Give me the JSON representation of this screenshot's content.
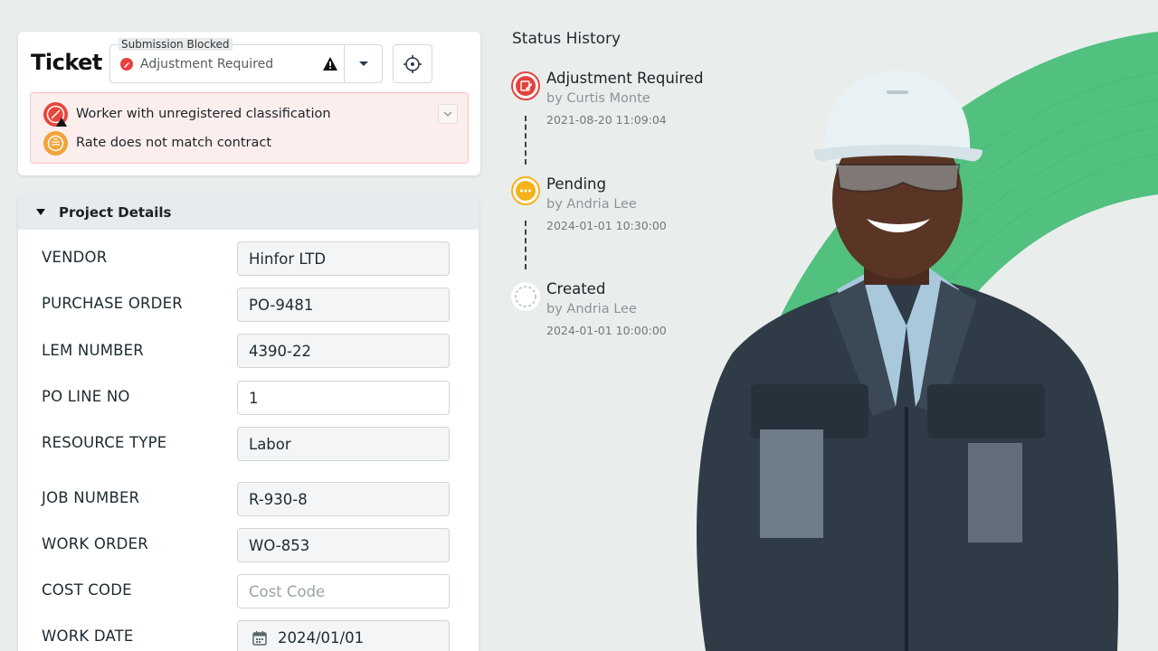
{
  "ticket": {
    "title": "Ticket",
    "status_label": "Submission Blocked",
    "status_value": "Adjustment Required",
    "issues": [
      {
        "text": "Worker with unregistered classification",
        "icon": "worker-warning-icon"
      },
      {
        "text": "Rate does not match contract",
        "icon": "rate-coin-icon"
      }
    ]
  },
  "details": {
    "title": "Project Details",
    "fields": [
      {
        "label": "VENDOR",
        "value": "Hinfor LTD"
      },
      {
        "label": "PURCHASE ORDER",
        "value": "PO-9481"
      },
      {
        "label": "LEM NUMBER",
        "value": "4390-22"
      },
      {
        "label": "PO LINE NO",
        "value": "1"
      },
      {
        "label": "RESOURCE TYPE",
        "value": "Labor"
      },
      {
        "label": "JOB NUMBER",
        "value": "R-930-8"
      },
      {
        "label": "WORK ORDER",
        "value": "WO-853"
      },
      {
        "label": "COST CODE",
        "value": "",
        "placeholder": "Cost Code"
      },
      {
        "label": "WORK DATE",
        "value": "2024/01/01"
      }
    ]
  },
  "history": {
    "title": "Status History",
    "entries": [
      {
        "status": "Adjustment Required",
        "by": "by Curtis Monte",
        "time": "2021-08-20 11:09:04",
        "color": "#e5413d"
      },
      {
        "status": "Pending",
        "by": "by Andria Lee",
        "time": "2024-01-01 10:30:00",
        "color": "#f6b21b"
      },
      {
        "status": "Created",
        "by": "by Andria Lee",
        "time": "2024-01-01 10:00:00",
        "color": "#b8bfc3"
      }
    ]
  },
  "colors": {
    "accent_green": "#52c07f",
    "error_red": "#e5413d",
    "pending_yellow": "#f6b21b",
    "alert_bg": "#fdeeee"
  }
}
